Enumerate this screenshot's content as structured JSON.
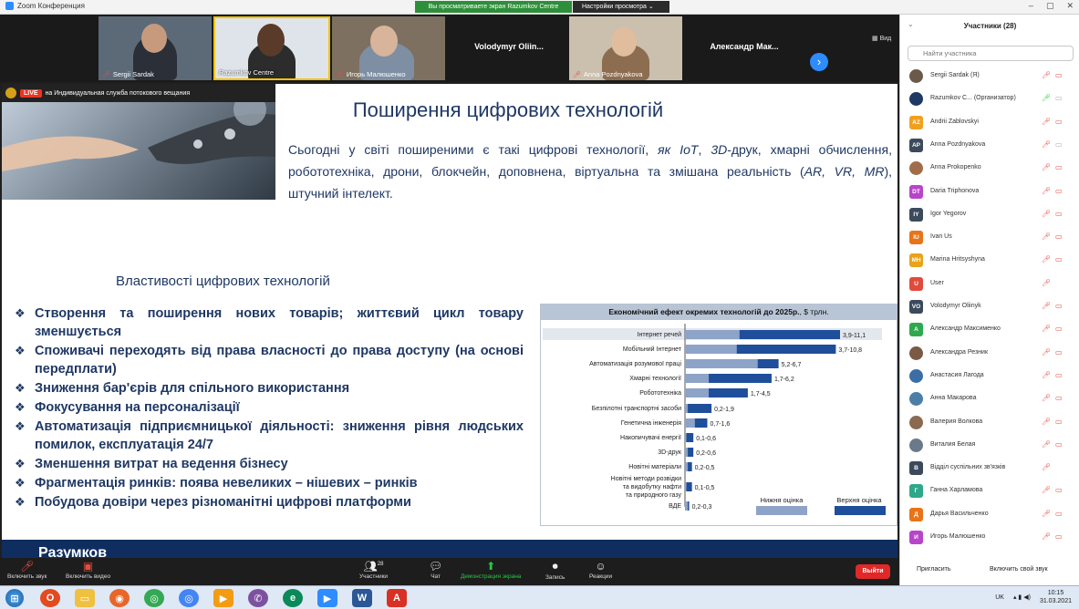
{
  "window": {
    "title": "Zoom Конференция",
    "view_banner": "Вы просматриваете экран Razumkov Centre",
    "view_options": "Настройки просмотра",
    "controls": [
      "–",
      "▢",
      "✕"
    ]
  },
  "strip": {
    "tiles": [
      {
        "name": "Sergii Sardak",
        "muted": true,
        "video": true
      },
      {
        "name": "Razumkov Centre",
        "muted": false,
        "video": true
      },
      {
        "name": "Игорь Малюшенко",
        "muted": true,
        "video": true
      },
      {
        "name": "Volodymyr Oliin...",
        "muted": false,
        "video": false
      },
      {
        "name": "Anna Pozdnyakova",
        "muted": true,
        "video": true
      },
      {
        "name": "Александр Мак...",
        "muted": false,
        "video": false
      }
    ],
    "view_label": "Вид"
  },
  "live": {
    "badge": "LIVE",
    "text": "на Индивидуальная служба потокового вещания"
  },
  "slide": {
    "title": "Поширення цифрових технологій",
    "intro_parts": [
      {
        "t": "Сьогодні у світі поширеними є такі цифрові технології, ",
        "i": false
      },
      {
        "t": "як IoT",
        "i": true
      },
      {
        "t": ", ",
        "i": false
      },
      {
        "t": "3D",
        "i": true
      },
      {
        "t": "-друк, хмарні обчислення, робототехніка, дрони, блокчейн, доповнена, віртуальна та змішана реальність (",
        "i": false
      },
      {
        "t": "AR, VR, MR",
        "i": true
      },
      {
        "t": "), штучний інтелект.",
        "i": false
      }
    ],
    "props_heading": "Властивості цифрових технологій",
    "props": [
      "Створення та поширення нових товарів; життєвий цикл товару зменшується",
      "Споживачі переходять від права власності до права доступу (на основі передплати)",
      "Зниження бар'єрів для спільного використання",
      "Фокусування на персоналізації",
      "Автоматизація підприємницької діяльності: зниження рівня людських помилок, експлуатація 24/7",
      "Зменшення витрат на ведення бізнесу",
      "Фрагментація ринків: поява невеликих – нішевих – ринків",
      "Побудова довіри через різноманітні цифрові платформи"
    ],
    "footer_text": "Разумков"
  },
  "chart_data": {
    "type": "bar",
    "orientation": "horizontal",
    "stacked_range": true,
    "title": "Економічний ефект окремих технологій до 2025р.",
    "title_unit": ", $ трлн.",
    "xlabel": "",
    "ylabel": "",
    "xlim": [
      0,
      11.1
    ],
    "grid": false,
    "legend_position": "bottom-right",
    "categories": [
      "Інтернет речей",
      "Мобільний Інтернет",
      "Автоматизація розумової праці",
      "Хмарні технології",
      "Робототехніка",
      "Безпілотні транспортні засоби",
      "Генетична інженерія",
      "Накопичувачі енергії",
      "3D-друк",
      "Новітні матеріали",
      "Новітні методи розвідки та видобутку нафти та природного газу",
      "ВДЕ"
    ],
    "value_labels": [
      "3,9-11,1",
      "3,7-10,8",
      "5,2-6,7",
      "1,7-6,2",
      "1,7-4,5",
      "0,2-1,9",
      "0,7-1,6",
      "0,1-0,6",
      "0,2-0,6",
      "0,2-0,5",
      "0,1-0,5",
      "0,2-0,3"
    ],
    "series": [
      {
        "name": "Нижня оцінка",
        "values": [
          3.9,
          3.7,
          5.2,
          1.7,
          1.7,
          0.2,
          0.7,
          0.1,
          0.2,
          0.2,
          0.1,
          0.2
        ]
      },
      {
        "name": "Верхня оцінка",
        "values": [
          11.1,
          10.8,
          6.7,
          6.2,
          4.5,
          1.9,
          1.6,
          0.6,
          0.6,
          0.5,
          0.5,
          0.3
        ]
      }
    ],
    "colors": {
      "low": "#8ea3c8",
      "high": "#1f4e9a"
    }
  },
  "panel": {
    "title": "Участники (28)",
    "search_placeholder": "Найти участника",
    "participants": [
      {
        "name": "Sergii Sardak (Я)",
        "initials": "",
        "color": "#6b5a4a",
        "mic": "off",
        "cam": "off"
      },
      {
        "name": "Razumkov C... (Организатор)",
        "initials": "",
        "color": "#1f3864",
        "mic": "on",
        "cam": "on"
      },
      {
        "name": "Andrii Zablovskyi",
        "initials": "AZ",
        "color": "#f0a020",
        "mic": "off",
        "cam": "off"
      },
      {
        "name": "Anna Pozdnyakova",
        "initials": "AP",
        "color": "#3c4a5c",
        "mic": "off",
        "cam": "on"
      },
      {
        "name": "Anna Prokopenko",
        "initials": "",
        "color": "#a06d4a",
        "mic": "off",
        "cam": "off"
      },
      {
        "name": "Daria Triphonova",
        "initials": "DT",
        "color": "#b845c9",
        "mic": "off",
        "cam": "off"
      },
      {
        "name": "Igor Yegorov",
        "initials": "IY",
        "color": "#3c4a5c",
        "mic": "off",
        "cam": "off"
      },
      {
        "name": "Ivan Us",
        "initials": "IU",
        "color": "#e8741a",
        "mic": "off",
        "cam": "off"
      },
      {
        "name": "Marina Hritsyshyna",
        "initials": "MH",
        "color": "#e8a319",
        "mic": "off",
        "cam": "off"
      },
      {
        "name": "User",
        "initials": "U",
        "color": "#e04b3c",
        "mic": "off",
        "cam": "none"
      },
      {
        "name": "Volodymyr Oliinyk",
        "initials": "VO",
        "color": "#3c4a5c",
        "mic": "off",
        "cam": "off"
      },
      {
        "name": "Александр Максименко",
        "initials": "А",
        "color": "#2fa84f",
        "mic": "off",
        "cam": "off"
      },
      {
        "name": "Александра Резник",
        "initials": "",
        "color": "#7a5a44",
        "mic": "off",
        "cam": "off"
      },
      {
        "name": "Анастасия Лагода",
        "initials": "",
        "color": "#3b6ea5",
        "mic": "off",
        "cam": "off"
      },
      {
        "name": "Анна Макарова",
        "initials": "",
        "color": "#4b7fa8",
        "mic": "off",
        "cam": "off"
      },
      {
        "name": "Валерия Волкова",
        "initials": "",
        "color": "#8a6a50",
        "mic": "off",
        "cam": "off"
      },
      {
        "name": "Виталия Белая",
        "initials": "",
        "color": "#6a7a8a",
        "mic": "off",
        "cam": "off"
      },
      {
        "name": "Відділ суспільних зв'язків",
        "initials": "В",
        "color": "#3c4a5c",
        "mic": "off",
        "cam": "none"
      },
      {
        "name": "Ганна Харламова",
        "initials": "Г",
        "color": "#2fa88a",
        "mic": "off",
        "cam": "off"
      },
      {
        "name": "Дарья Васильченко",
        "initials": "Д",
        "color": "#e8741a",
        "mic": "off",
        "cam": "off"
      },
      {
        "name": "Игорь Малюшенко",
        "initials": "И",
        "color": "#b845c9",
        "mic": "off",
        "cam": "off"
      }
    ],
    "invite": "Пригласить",
    "unmute_self": "Включить свой звук"
  },
  "toolbar": {
    "audio": "Включить звук",
    "video": "Включить видео",
    "participants": "Участники",
    "participants_count": "28",
    "chat": "Чат",
    "share": "Демонстрация экрана",
    "record": "Запись",
    "reactions": "Реакции",
    "end": "Выйти"
  },
  "taskbar": {
    "lang": "UK",
    "time": "10:15",
    "date": "31.03.2021"
  }
}
